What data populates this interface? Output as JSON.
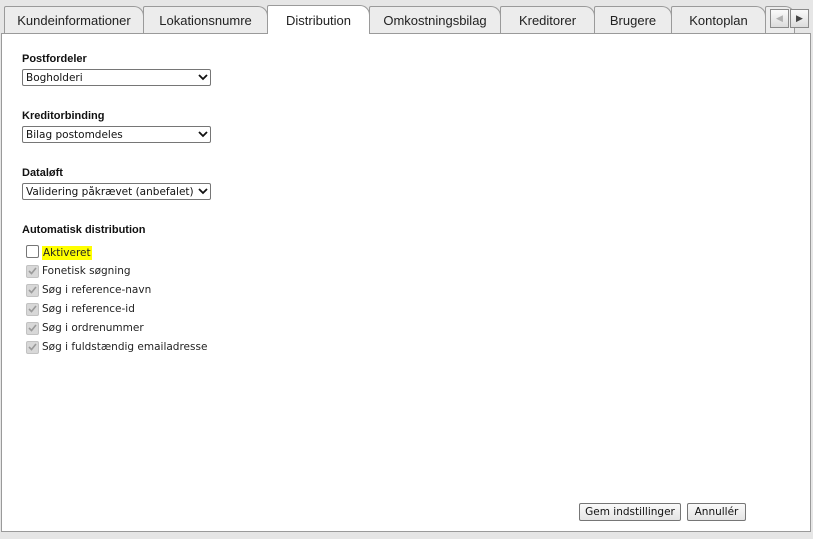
{
  "tabs": [
    {
      "label": "Kundeinformationer",
      "active": false
    },
    {
      "label": "Lokationsnumre",
      "active": false
    },
    {
      "label": "Distribution",
      "active": true
    },
    {
      "label": "Omkostningsbilag",
      "active": false
    },
    {
      "label": "Kreditorer",
      "active": false
    },
    {
      "label": "Brugere",
      "active": false
    },
    {
      "label": "Kontoplan",
      "active": false
    },
    {
      "label": "",
      "active": false
    }
  ],
  "tab_scroll": {
    "left_icon": "chevron-left-icon",
    "right_icon": "chevron-right-icon"
  },
  "postfordeler": {
    "label": "Postfordeler",
    "value": "Bogholderi"
  },
  "kreditorbinding": {
    "label": "Kreditorbinding",
    "value": "Bilag postomdeles"
  },
  "dataloft": {
    "label": "Dataløft",
    "value": "Validering påkrævet (anbefalet)"
  },
  "auto_distribution": {
    "label": "Automatisk distribution",
    "options": [
      {
        "label": "Aktiveret",
        "checked": false,
        "enabled": true,
        "highlight": "#ffff00"
      },
      {
        "label": "Fonetisk søgning",
        "checked": true,
        "enabled": false
      },
      {
        "label": "Søg i reference-navn",
        "checked": true,
        "enabled": false
      },
      {
        "label": "Søg i reference-id",
        "checked": true,
        "enabled": false
      },
      {
        "label": "Søg i ordrenummer",
        "checked": true,
        "enabled": false
      },
      {
        "label": "Søg i fuldstændig emailadresse",
        "checked": true,
        "enabled": false
      }
    ]
  },
  "buttons": {
    "save": "Gem indstillinger",
    "cancel": "Annullér"
  }
}
